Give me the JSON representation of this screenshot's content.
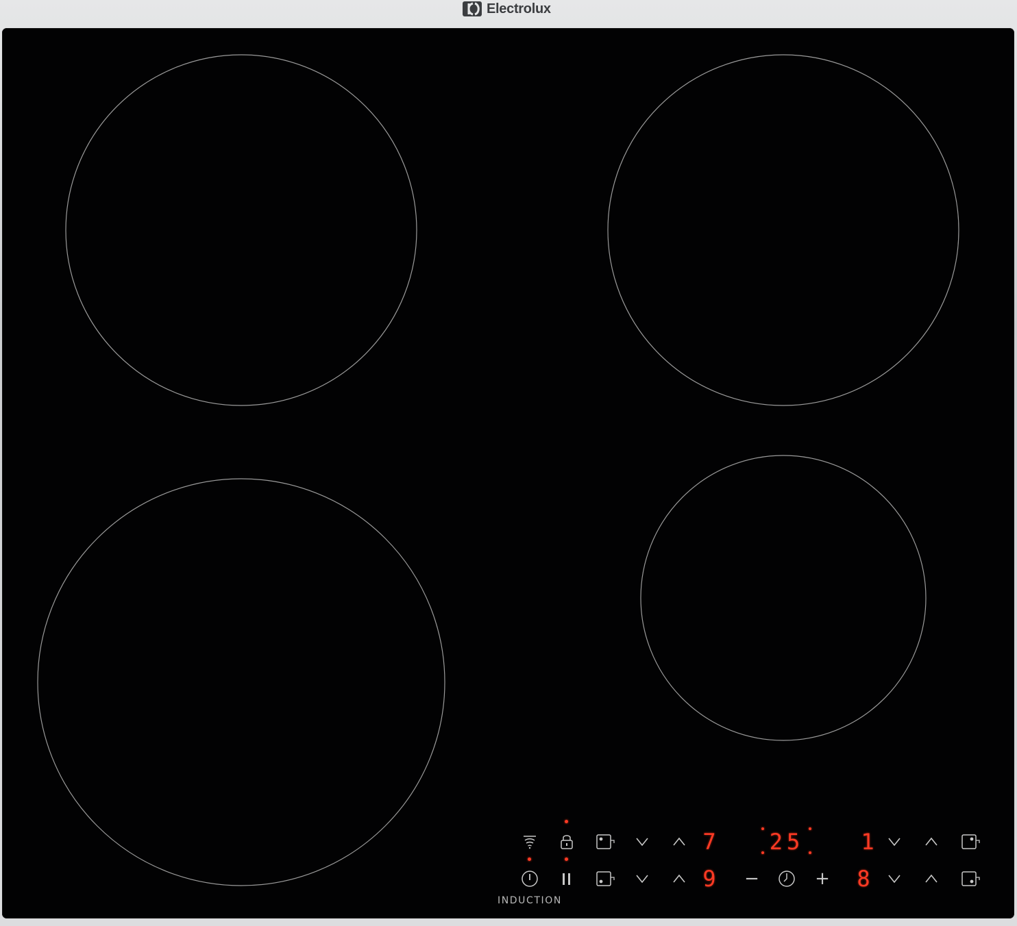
{
  "brand": {
    "name": "Electrolux",
    "logo_icon": "electrolux-logo-icon"
  },
  "cooktop": {
    "type_label": "INDUCTION",
    "glass_color": "#020203",
    "ring_color": "#9a9a9a",
    "display_color": "#ff3a24",
    "zones": [
      "front-left",
      "rear-left",
      "rear-right",
      "front-right"
    ]
  },
  "controls": {
    "hob2hood_icon": "hob2hood-icon",
    "lock_icon": "lock-icon",
    "power_icon": "power-icon",
    "pause_icon": "pause-icon",
    "timer_icon": "timer-icon",
    "minus_label": "−",
    "plus_label": "+",
    "timer_display": "25",
    "rear_left_level": "7",
    "front_left_level": "9",
    "rear_right_level": "1",
    "front_right_level": "8"
  }
}
